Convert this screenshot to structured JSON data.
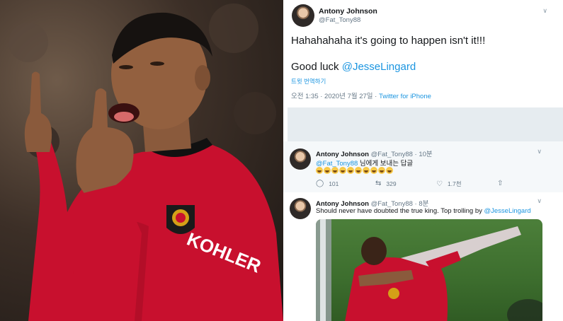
{
  "left_photo": {
    "subject": "celebrating football player in red Manchester United kit",
    "shirt_sponsor": "KOHLER"
  },
  "main_tweet": {
    "author_name": "Antony Johnson",
    "author_handle": "@Fat_Tony88",
    "line1": "Hahahahaha it's going to happen isn't it!!!",
    "line2_prefix": "Good luck ",
    "line2_mention": "@JesseLingard",
    "translate_label": "트윗 번역하기",
    "timestamp": "오전 1:35 · 2020년 7월 27일 · ",
    "source": "Twitter for iPhone"
  },
  "reply1": {
    "author_name": "Antony Johnson",
    "author_handle": "@Fat_Tony88 · 10분",
    "text_mention": "@Fat_Tony88",
    "text_suffix": " 님에게 보내는 답글",
    "emoji_count": 10,
    "emoji_name": "rolling-on-floor-laughing",
    "replies": "101",
    "retweets": "329",
    "likes": "1.7천"
  },
  "reply2": {
    "author_name": "Antony Johnson",
    "author_handle": "@Fat_Tony88 · 8분",
    "text_prefix": "Should never have doubted the true king.  Top trolling by ",
    "text_mention": "@JesseLingard"
  },
  "colors": {
    "link": "#1b95e0",
    "muted": "#657786",
    "divider": "#e6ecf0",
    "kit_red": "#c8102e"
  }
}
